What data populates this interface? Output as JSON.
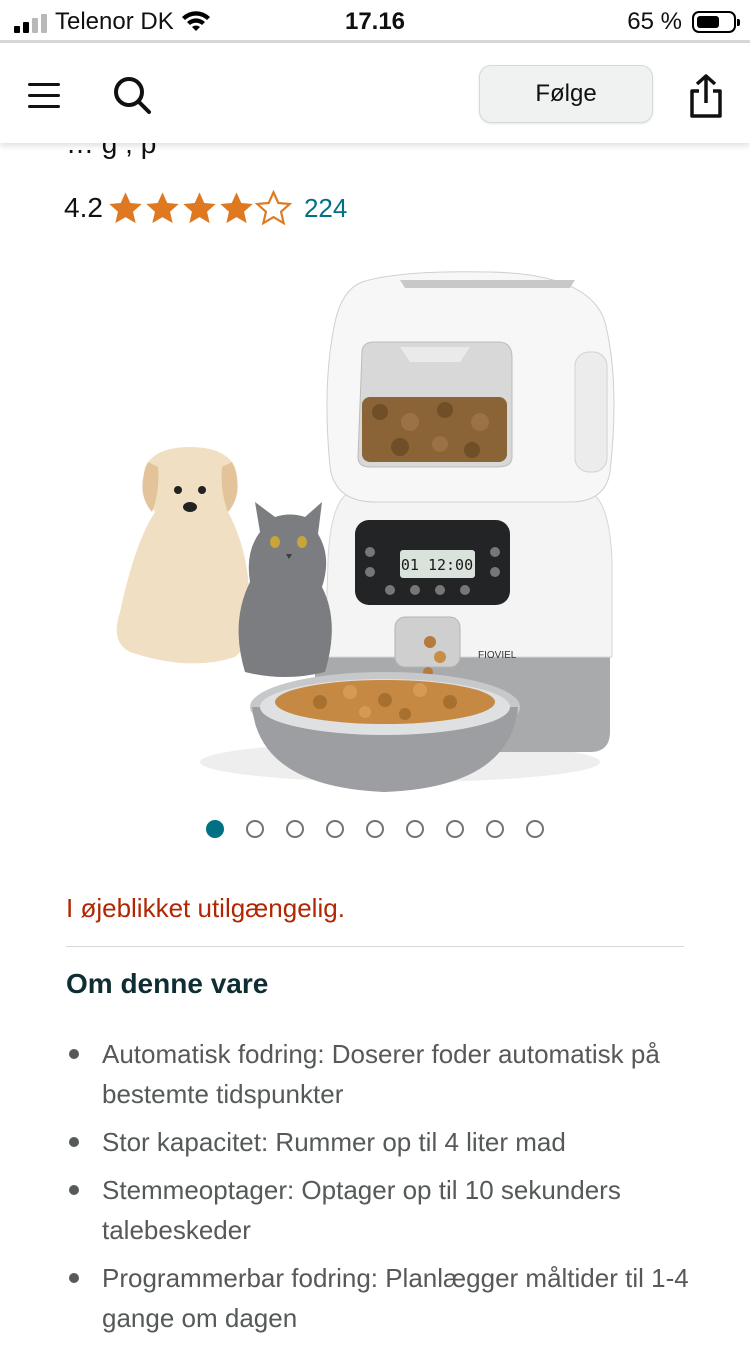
{
  "status_bar": {
    "carrier": "Telenor DK",
    "time": "17.16",
    "battery": "65 %",
    "battery_level": 0.65
  },
  "nav": {
    "menu_icon": "hamburger-menu-icon",
    "search_icon": "search-icon",
    "follow_label": "Følge",
    "share_icon": "share-icon"
  },
  "product": {
    "title_partial": "…     g       ,      p",
    "rating_value": "4.2",
    "rating_stars": 4.2,
    "rating_count": "224",
    "image_logo": "FIOVIEL",
    "image_display_time": "01 12:00",
    "carousel_count": 9,
    "carousel_active": 1,
    "availability": "I øjeblikket utilgængelig."
  },
  "about": {
    "title": "Om denne vare",
    "bullets": [
      "Automatisk fodring: Doserer foder automatisk på bestemte tidspunkter",
      "Stor kapacitet: Rummer op til 4 liter mad",
      "Stemmeoptager: Optager op til 10 sekunders talebeskeder",
      "Programmerbar fodring: Planlægger måltider til 1-4 gange om dagen"
    ]
  },
  "colors": {
    "star": "#de7921",
    "link": "#007185",
    "unavailable": "#b12704",
    "active_dot": "#007185"
  }
}
